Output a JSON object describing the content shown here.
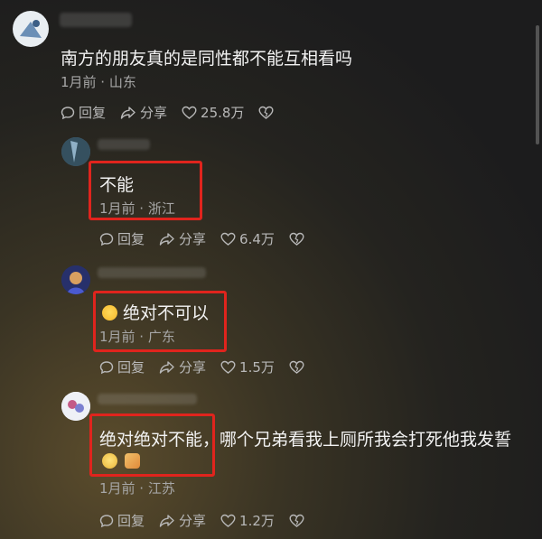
{
  "comments": [
    {
      "text": "南方的朋友真的是同性都不能互相看吗",
      "meta": "1月前 · 山东",
      "reply": "回复",
      "share": "分享",
      "likes": "25.8万"
    },
    {
      "text": "不能",
      "meta": "1月前 · 浙江",
      "reply": "回复",
      "share": "分享",
      "likes": "6.4万"
    },
    {
      "text": "绝对不可以",
      "meta": "1月前 · 广东",
      "reply": "回复",
      "share": "分享",
      "likes": "1.5万"
    },
    {
      "text": "绝对绝对不能，哪个兄弟看我上厕所我会打死他我发誓",
      "meta": "1月前 · 江苏",
      "reply": "回复",
      "share": "分享",
      "likes": "1.2万"
    }
  ],
  "colors": {
    "highlight": "#e0241d",
    "meta_text": "#a6a6a6"
  }
}
